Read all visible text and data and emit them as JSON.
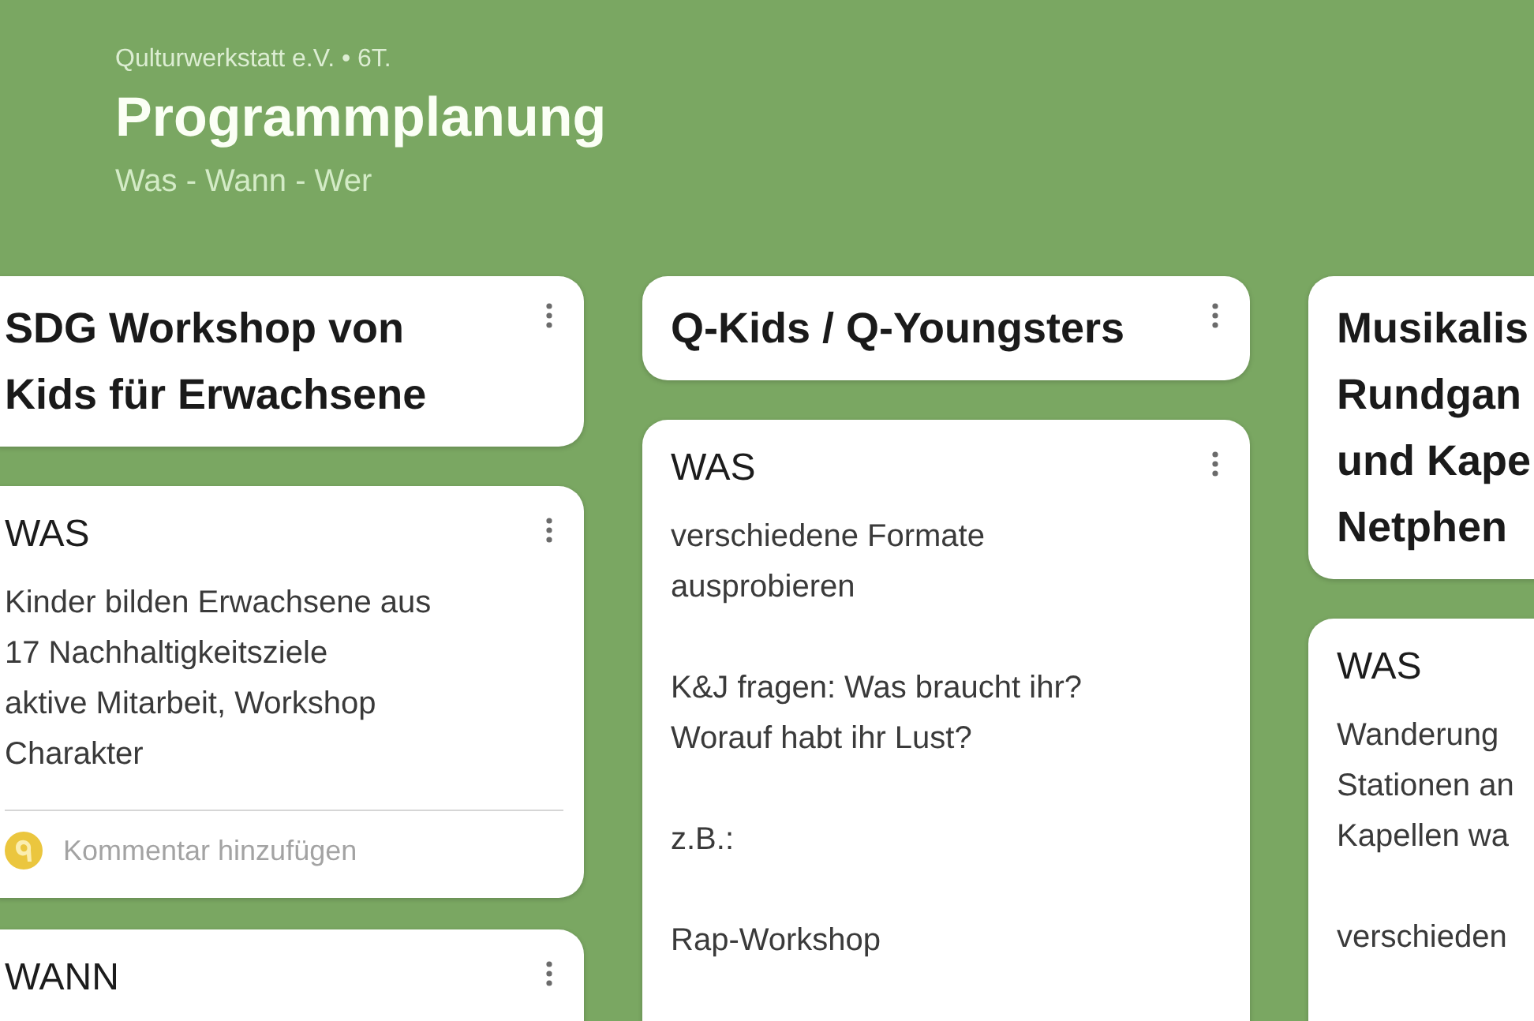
{
  "header": {
    "organization": "Qulturwerkstatt e.V. • 6T.",
    "title": "Programmplanung",
    "subtitle": "Was - Wann - Wer"
  },
  "columns": [
    {
      "title": "SDG Workshop von\nKids für Erwachsene",
      "cards": [
        {
          "heading": "WAS",
          "paragraphs": [
            "Kinder bilden Erwachsene aus\n17 Nachhaltigkeitsziele\naktive Mitarbeit, Workshop\nCharakter"
          ],
          "comment": {
            "placeholder": "Kommentar hinzufügen"
          }
        },
        {
          "heading": "WANN"
        }
      ]
    },
    {
      "title": "Q-Kids / Q-Youngsters",
      "cards": [
        {
          "heading": "WAS",
          "paragraphs": [
            "verschiedene Formate\nausprobieren",
            "K&J fragen: Was braucht ihr?\nWorauf habt ihr Lust?",
            "z.B.:",
            "Rap-Workshop"
          ]
        }
      ]
    },
    {
      "title": "Musikalis\nRundgan\nund Kape\nNetphen",
      "cards": [
        {
          "heading": "WAS",
          "paragraphs": [
            "Wanderung\nStationen an\nKapellen wa",
            "verschieden"
          ]
        }
      ]
    }
  ]
}
